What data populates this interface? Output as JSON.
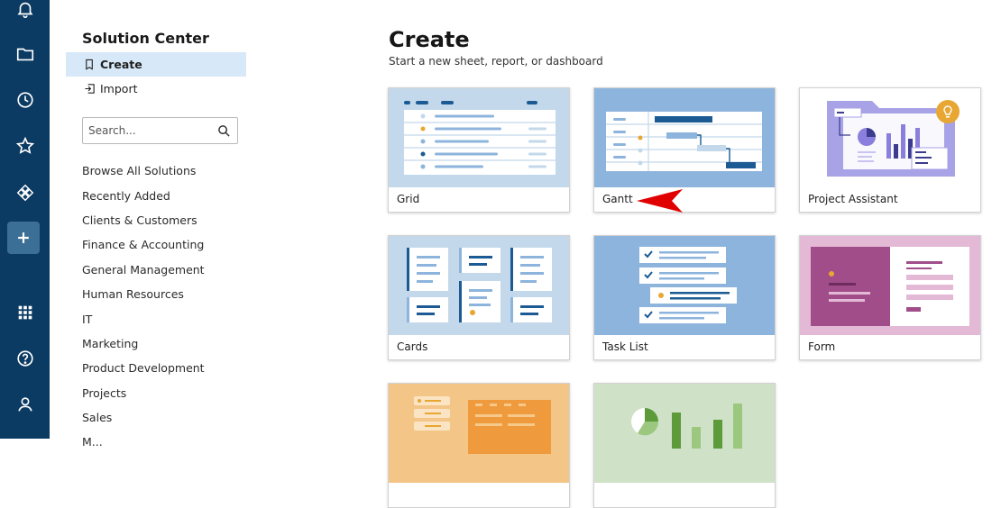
{
  "rail": {
    "icons": [
      "bell-icon",
      "folder-icon",
      "clock-icon",
      "star-icon",
      "apps-diamond-icon",
      "plus-icon",
      "grid-icon",
      "help-icon",
      "user-icon"
    ],
    "color": "#0b3a62",
    "add_color": "#3b6f96"
  },
  "sidebar": {
    "title": "Solution Center",
    "nav": [
      {
        "label": "Create",
        "icon": "new-sheet-icon",
        "selected": true
      },
      {
        "label": "Import",
        "icon": "import-icon",
        "selected": false
      }
    ],
    "search": {
      "placeholder": "Search..."
    },
    "categories": [
      "Browse All Solutions",
      "Recently Added",
      "Clients & Customers",
      "Finance & Accounting",
      "General Management",
      "Human Resources",
      "IT",
      "Marketing",
      "Product Development",
      "Projects",
      "Sales",
      "M..."
    ]
  },
  "main": {
    "title": "Create",
    "subtitle": "Start a new sheet, report, or dashboard",
    "cards": [
      {
        "label": "Grid"
      },
      {
        "label": "Gantt"
      },
      {
        "label": "Project Assistant"
      },
      {
        "label": "Cards"
      },
      {
        "label": "Task List"
      },
      {
        "label": "Form"
      },
      {
        "label": ""
      },
      {
        "label": ""
      }
    ]
  },
  "colors": {
    "selected_bg": "#d7e8f8",
    "thumb_blue": "#8db4dc",
    "thumb_light": "#c3d8ea",
    "dark_blue": "#1b5a93",
    "accent_orange": "#e8a632",
    "form_purple": "#a14d8a",
    "assistant_purple": "#a8a2e6",
    "report_orange": "#f3c587",
    "dashboard_green": "#cfe2c8",
    "arrow_red": "#e00000"
  }
}
